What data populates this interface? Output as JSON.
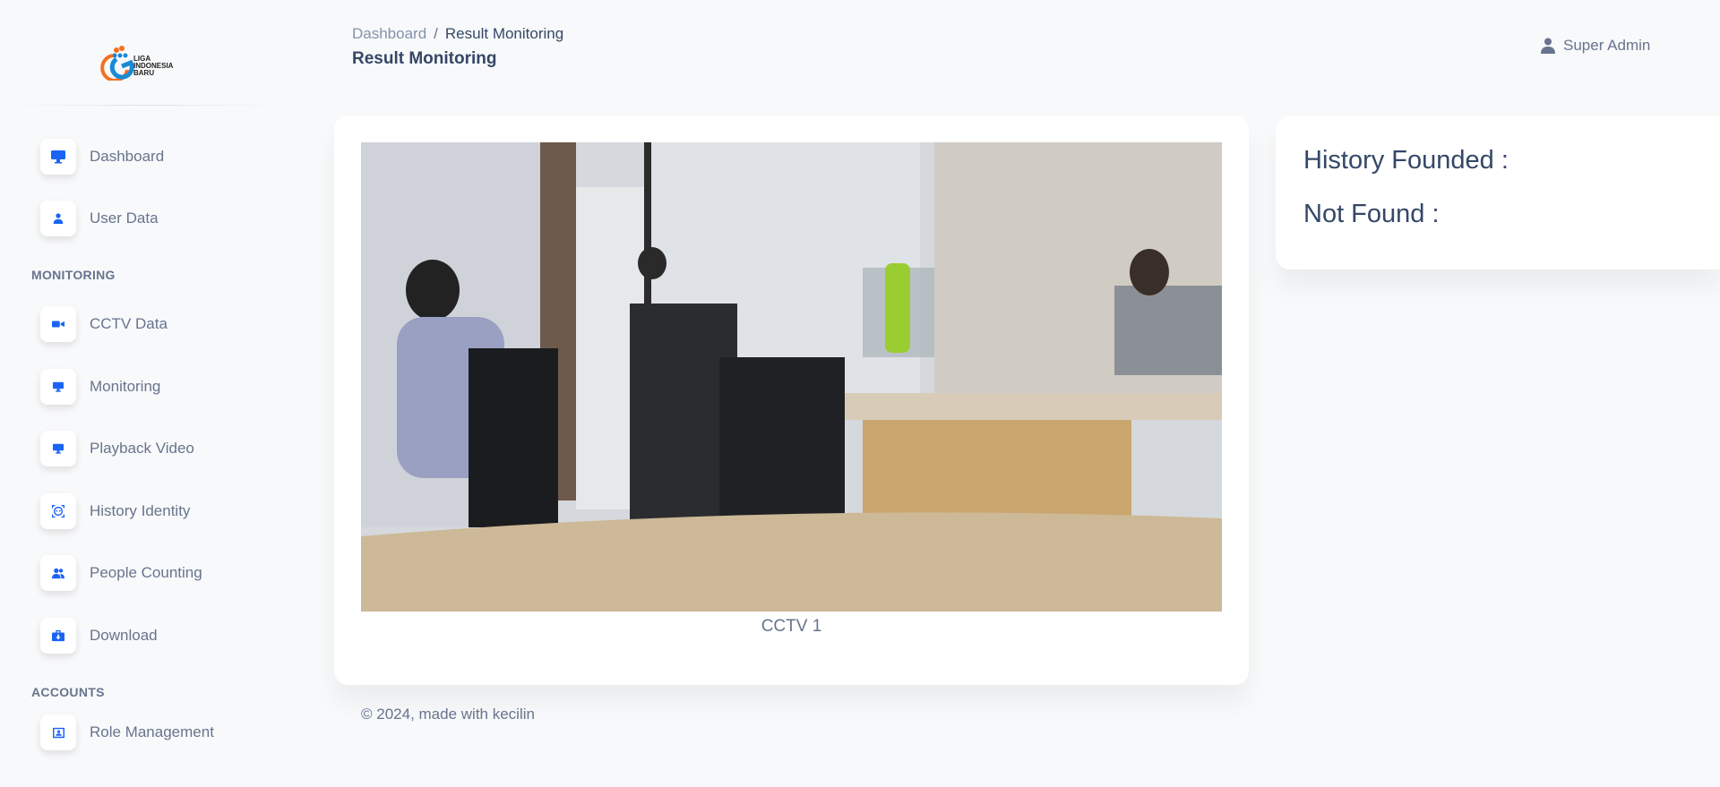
{
  "brand": {
    "logo_text": "LIGA INDONESIA BARU",
    "colors": {
      "accent": "#1a63f5",
      "orange": "#f37021"
    }
  },
  "sidebar": {
    "items": [
      {
        "label": "Dashboard",
        "icon": "monitor-icon"
      },
      {
        "label": "User Data",
        "icon": "user-icon"
      }
    ],
    "sections": [
      {
        "title": "MONITORING",
        "items": [
          {
            "label": "CCTV Data",
            "icon": "video-camera-icon"
          },
          {
            "label": "Monitoring",
            "icon": "monitor-icon"
          },
          {
            "label": "Playback Video",
            "icon": "monitor-icon"
          },
          {
            "label": "History Identity",
            "icon": "face-scan-icon"
          },
          {
            "label": "People Counting",
            "icon": "users-icon"
          },
          {
            "label": "Download",
            "icon": "download-box-icon"
          }
        ]
      },
      {
        "title": "ACCOUNTS",
        "items": [
          {
            "label": "Role Management",
            "icon": "id-card-icon"
          }
        ]
      }
    ]
  },
  "header": {
    "breadcrumb": [
      "Dashboard",
      "Result Monitoring"
    ],
    "separator": "/",
    "title": "Result Monitoring",
    "user": "Super Admin"
  },
  "main": {
    "camera_caption": "CCTV 1"
  },
  "stats": {
    "history_founded": "History Founded :",
    "not_found": "Not Found :"
  },
  "footer": "© 2024, made with kecilin"
}
